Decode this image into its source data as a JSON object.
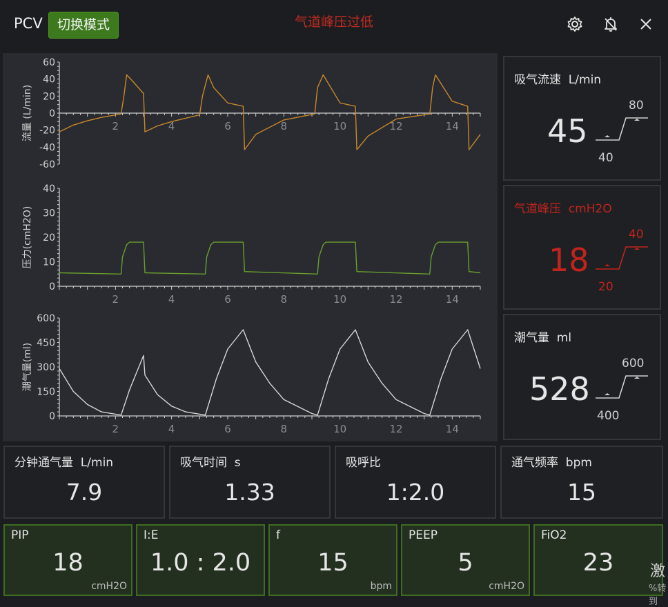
{
  "header": {
    "mode": "PCV",
    "switch_label": "切换模式",
    "alarm_message": "气道峰压过低"
  },
  "colors": {
    "flow": "#c8882a",
    "pressure": "#6a9e2c",
    "volume": "#d6d6d6",
    "alarm": "#c0241d",
    "setting_border": "#3d6c22"
  },
  "chart_data": [
    {
      "type": "line",
      "ylabel": "流量 (L/min)",
      "ylim": [
        -60,
        60
      ],
      "yticks": [
        "60",
        "40",
        "20",
        "0",
        "-20",
        "-40",
        "-60"
      ],
      "xlim": [
        0,
        15
      ],
      "xticks": [
        "2",
        "4",
        "6",
        "8",
        "10",
        "12",
        "14"
      ],
      "series": [
        {
          "x": [
            0,
            0.5,
            1,
            1.5,
            2.2,
            2.3,
            2.4,
            2.6,
            3.0,
            3.05,
            3.5,
            4,
            5,
            5.1,
            5.3,
            5.5,
            6,
            6.55,
            6.6,
            7,
            8,
            9.1,
            9.2,
            9.4,
            10,
            10.55,
            10.6,
            11,
            12,
            13.2,
            13.3,
            13.4,
            14,
            14.55,
            14.6,
            15
          ],
          "values": [
            -22,
            -14,
            -9,
            -5,
            -1,
            20,
            45,
            38,
            23,
            -22,
            -15,
            -10,
            -2,
            20,
            45,
            30,
            12,
            8,
            -43,
            -25,
            -8,
            -1,
            30,
            45,
            12,
            8,
            -43,
            -27,
            -7,
            -1,
            30,
            45,
            14,
            8,
            -43,
            -25
          ]
        }
      ]
    },
    {
      "type": "line",
      "ylabel": "压力(cmH2O)",
      "ylim": [
        0,
        40
      ],
      "yticks": [
        "40",
        "30",
        "20",
        "10",
        "0"
      ],
      "xlim": [
        0,
        15
      ],
      "xticks": [
        "2",
        "4",
        "6",
        "8",
        "10",
        "12",
        "14"
      ],
      "series": [
        {
          "x": [
            0,
            2.2,
            2.25,
            2.4,
            2.5,
            3.0,
            3.05,
            5.2,
            5.25,
            5.4,
            5.5,
            6.55,
            6.6,
            9.2,
            9.25,
            9.4,
            9.5,
            10.55,
            10.6,
            13.2,
            13.25,
            13.4,
            13.5,
            14.55,
            14.6,
            15
          ],
          "values": [
            5.5,
            5,
            12,
            17,
            18,
            18,
            5.5,
            5,
            12,
            17,
            18,
            18,
            6,
            5,
            12,
            17,
            18,
            18,
            6,
            5,
            12,
            17,
            18,
            18,
            6,
            5.5
          ]
        }
      ]
    },
    {
      "type": "line",
      "ylabel": "潮气量(ml)",
      "ylim": [
        0,
        600
      ],
      "yticks": [
        "600",
        "450",
        "300",
        "150",
        "0"
      ],
      "xlim": [
        0,
        15
      ],
      "xticks": [
        "2",
        "4",
        "6",
        "8",
        "10",
        "12",
        "14"
      ],
      "series": [
        {
          "x": [
            0,
            0.5,
            1,
            1.5,
            2.2,
            2.5,
            3.0,
            3.05,
            3.5,
            4,
            4.5,
            5.2,
            5.6,
            6.0,
            6.55,
            7.0,
            7.5,
            8,
            9,
            9.2,
            9.6,
            10.0,
            10.55,
            11.0,
            11.5,
            12,
            13,
            13.2,
            13.6,
            14.0,
            14.55,
            15
          ],
          "values": [
            290,
            150,
            70,
            25,
            5,
            160,
            370,
            250,
            130,
            60,
            25,
            5,
            230,
            410,
            528,
            330,
            200,
            100,
            15,
            5,
            230,
            410,
            528,
            330,
            200,
            100,
            15,
            5,
            230,
            410,
            528,
            290
          ]
        }
      ]
    }
  ],
  "monitor_cards": [
    {
      "title": "吸气流速  L/min",
      "value": "45",
      "upper": "80",
      "lower": "40",
      "alarm": false
    },
    {
      "title": "气道峰压  cmH2O",
      "value": "18",
      "upper": "40",
      "lower": "20",
      "alarm": true
    },
    {
      "title": "潮气量  ml",
      "value": "528",
      "upper": "600",
      "lower": "400",
      "alarm": false
    }
  ],
  "stats": [
    {
      "title": "分钟通气量  L/min",
      "value": "7.9"
    },
    {
      "title": "吸气时间  s",
      "value": "1.33"
    },
    {
      "title": "吸呼比",
      "value": "1:2.0"
    },
    {
      "title": "通气频率  bpm",
      "value": "15"
    }
  ],
  "settings": [
    {
      "name": "PIP",
      "value": "18",
      "unit": "cmH2O"
    },
    {
      "name": "I:E",
      "value": "1.0 : 2.0",
      "unit": ""
    },
    {
      "name": "f",
      "value": "15",
      "unit": "bpm"
    },
    {
      "name": "PEEP",
      "value": "5",
      "unit": "cmH2O"
    },
    {
      "name": "FiO2",
      "value": "23",
      "unit": ""
    }
  ],
  "edge": {
    "text": "激",
    "sub": "%转到"
  },
  "icons": [
    "settings-gear-icon",
    "alarm-mute-bell-icon",
    "close-icon"
  ]
}
